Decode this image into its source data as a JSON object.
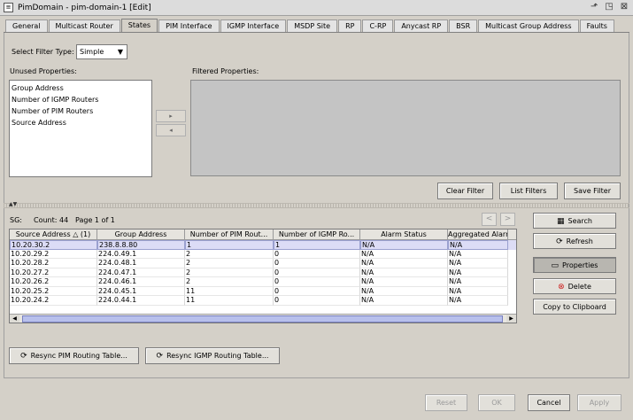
{
  "window": {
    "title": "PimDomain - pim-domain-1 [Edit]"
  },
  "tabs": [
    "General",
    "Multicast Router",
    "States",
    "PIM Interface",
    "IGMP Interface",
    "MSDP Site",
    "RP",
    "C-RP",
    "Anycast RP",
    "BSR",
    "Multicast Group Address",
    "Faults"
  ],
  "active_tab": "States",
  "filter": {
    "type_label": "Select Filter Type:",
    "type_value": "Simple",
    "unused_label": "Unused Properties:",
    "filtered_label": "Filtered Properties:",
    "unused_items": [
      "Group Address",
      "Number of IGMP Routers",
      "Number of PIM Routers",
      "Source Address"
    ],
    "move_right": "▸",
    "move_left": "◂",
    "clear_label": "Clear Filter",
    "list_label": "List Filters",
    "save_label": "Save Filter"
  },
  "results": {
    "sg_label": "SG:",
    "count_text": "Count: 44",
    "page_text": "Page 1 of 1",
    "columns": [
      "Source Address △ (1)",
      "Group Address",
      "Number of PIM Rout...",
      "Number of IGMP Ro...",
      "Alarm Status",
      "Aggregated Alarm"
    ],
    "rows": [
      [
        "10.20.30.2",
        "238.8.8.80",
        "1",
        "1",
        "N/A",
        "N/A"
      ],
      [
        "10.20.29.2",
        "224.0.49.1",
        "2",
        "0",
        "N/A",
        "N/A"
      ],
      [
        "10.20.28.2",
        "224.0.48.1",
        "2",
        "0",
        "N/A",
        "N/A"
      ],
      [
        "10.20.27.2",
        "224.0.47.1",
        "2",
        "0",
        "N/A",
        "N/A"
      ],
      [
        "10.20.26.2",
        "224.0.46.1",
        "2",
        "0",
        "N/A",
        "N/A"
      ],
      [
        "10.20.25.2",
        "224.0.45.1",
        "11",
        "0",
        "N/A",
        "N/A"
      ],
      [
        "10.20.24.2",
        "224.0.44.1",
        "11",
        "0",
        "N/A",
        "N/A"
      ]
    ]
  },
  "side_buttons": {
    "search": "Search",
    "refresh": "Refresh",
    "properties": "Properties",
    "delete": "Delete",
    "copy": "Copy to Clipboard"
  },
  "resync": {
    "pim": "Resync PIM Routing Table...",
    "igmp": "Resync IGMP Routing Table..."
  },
  "dialog_buttons": {
    "reset": "Reset",
    "ok": "OK",
    "cancel": "Cancel",
    "apply": "Apply"
  },
  "colors": {
    "selection": "#dcdcf6",
    "delete_icon": "#cc2020",
    "scroll_thumb": "#b8c0ec"
  }
}
